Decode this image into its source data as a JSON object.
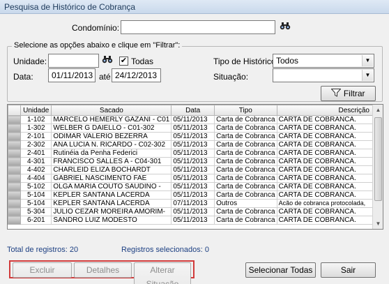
{
  "window": {
    "title": "Pesquisa de Histórico de Cobrança"
  },
  "top": {
    "condominio_label": "Condomínio:",
    "condominio_value": ""
  },
  "filter": {
    "legend": "Selecione as opções abaixo e clique em \"Filtrar\":",
    "unidade_label": "Unidade:",
    "unidade_value": "",
    "todas_label": "Todas",
    "todas_checked": true,
    "data_label": "Data:",
    "data_from": "01/11/2013",
    "ate_label": "até",
    "data_to": "24/12/2013",
    "tipo_label": "Tipo de Histórico:",
    "tipo_value": "Todos",
    "situacao_label": "Situação:",
    "situacao_value": "",
    "filtrar_label": "Filtrar"
  },
  "table": {
    "columns": [
      "Unidade",
      "Sacado",
      "Data",
      "Tipo",
      "Descrição"
    ],
    "rows": [
      [
        "1-102",
        "MARCELO HEMERLY GAZANI - C01",
        "05/11/2013",
        "Carta de Cobranca",
        "CARTA DE COBRANCA."
      ],
      [
        "1-302",
        "WELBER G DAIELLO - C01-302",
        "05/11/2013",
        "Carta de Cobranca",
        "CARTA DE COBRANCA."
      ],
      [
        "2-101",
        "ODIMAR VALERIO BEZERRA",
        "05/11/2013",
        "Carta de Cobranca",
        "CARTA DE COBRANCA."
      ],
      [
        "2-302",
        "ANA LUCIA N. RICARDO - C02-302",
        "05/11/2013",
        "Carta de Cobranca",
        "CARTA DE COBRANCA."
      ],
      [
        "2-401",
        "Rutinéia da Penha Federici",
        "05/11/2013",
        "Carta de Cobranca",
        "CARTA DE COBRANCA."
      ],
      [
        "4-301",
        "FRANCISCO SALLES A - C04-301",
        "05/11/2013",
        "Carta de Cobranca",
        "CARTA DE COBRANCA."
      ],
      [
        "4-402",
        "CHARLEID ELIZA BOCHARDT",
        "05/11/2013",
        "Carta de Cobranca",
        "CARTA DE COBRANCA."
      ],
      [
        "4-404",
        "GABRIEL NASCIMENTO FAE",
        "05/11/2013",
        "Carta de Cobranca",
        "CARTA DE COBRANCA."
      ],
      [
        "5-102",
        "OLGA MARIA COUTO SAUDINO -",
        "05/11/2013",
        "Carta de Cobranca",
        "CARTA DE COBRANCA."
      ],
      [
        "5-104",
        "KEPLER SANTANA LACERDA",
        "05/11/2013",
        "Carta de Cobranca",
        "CARTA DE COBRANCA."
      ],
      [
        "5-104",
        "KEPLER SANTANA LACERDA",
        "07/11/2013",
        "Outros",
        "Acão de cobranca protocolada,"
      ],
      [
        "5-304",
        "JULIO CEZAR MOREIRA AMORIM-",
        "05/11/2013",
        "Carta de Cobranca",
        "CARTA DE COBRANCA."
      ],
      [
        "6-201",
        "SANDRO LUIZ MODESTO",
        "05/11/2013",
        "Carta de Cobranca",
        "CARTA DE COBRANCA."
      ]
    ]
  },
  "status": {
    "total_label": "Total de registros: 20",
    "selected_label": "Registros selecionados: 0"
  },
  "buttons": {
    "excluir": "Excluir",
    "detalhes": "Detalhes",
    "alterar": "Alterar Situação",
    "selecionar": "Selecionar Todas",
    "sair": "Sair"
  },
  "icons": {
    "search": "binoculars-icon",
    "filter": "funnel-icon",
    "dropdown": "chevron-down-icon",
    "checkbox": "checkmark-icon"
  }
}
